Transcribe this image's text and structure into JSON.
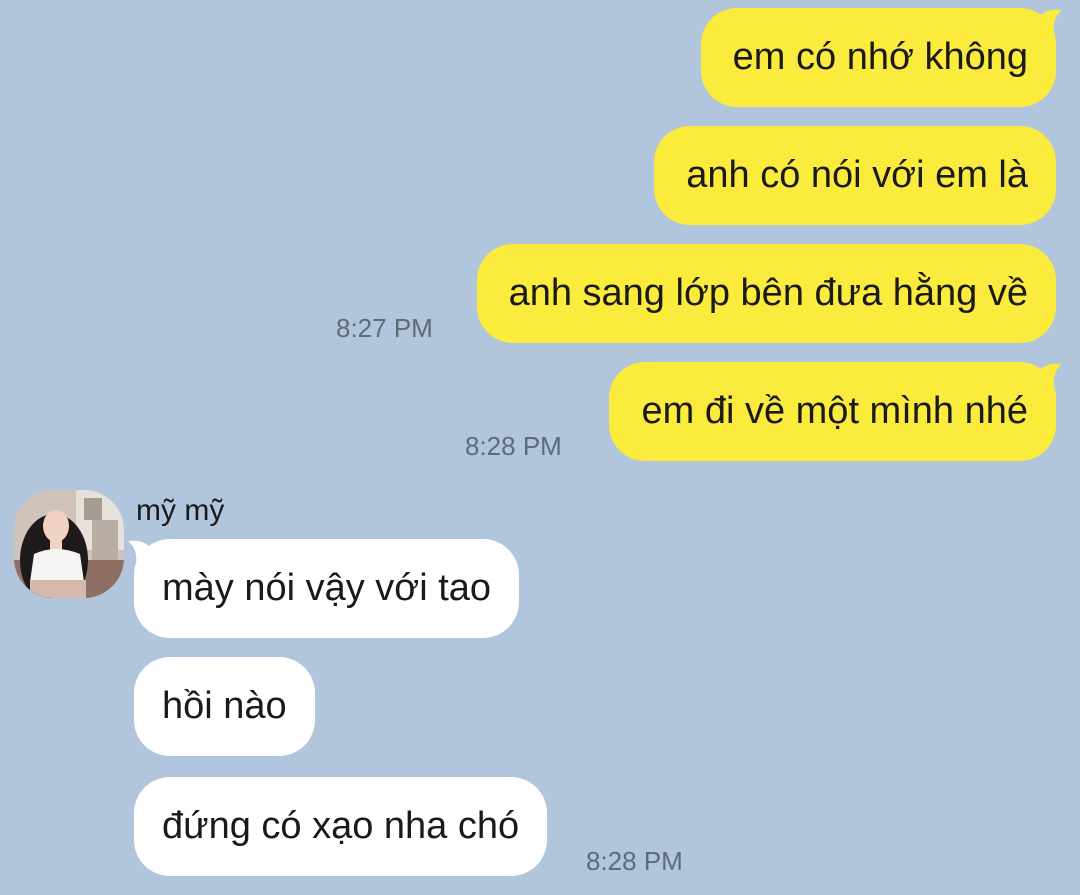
{
  "outgoing": [
    {
      "text": "em có nhớ không"
    },
    {
      "text": "anh có nói với em là"
    },
    {
      "text": "anh sang lớp bên đưa hằng về",
      "time": "8:27 PM"
    },
    {
      "text": "em đi về một mình nhé",
      "time": "8:28 PM"
    }
  ],
  "incoming_group": {
    "sender": "mỹ mỹ",
    "messages": [
      {
        "text": "mày nói vậy với tao"
      },
      {
        "text": "hồi nào"
      },
      {
        "text": "đứng có xạo nha chó",
        "time": "8:28 PM"
      }
    ]
  },
  "colors": {
    "background": "#b1c6dc",
    "outgoing_bubble": "#fbeb3c",
    "incoming_bubble": "#ffffff",
    "timestamp": "#5f6b78"
  }
}
